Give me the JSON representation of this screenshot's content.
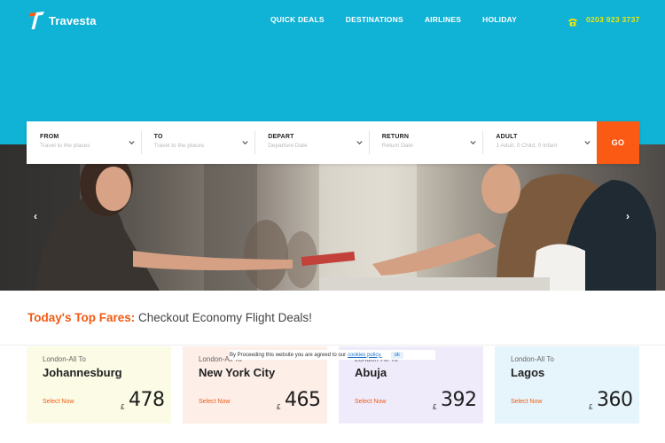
{
  "header": {
    "logo_text": "Travesta",
    "nav": [
      "QUICK DEALS",
      "DESTINATIONS",
      "AIRLINES",
      "HOLIDAY"
    ],
    "phone": "0203 923 3737"
  },
  "colors": {
    "brand_cyan": "#10b2d6",
    "accent_orange": "#fa5a14",
    "phone_yellow": "#f2e600"
  },
  "hero": {
    "prev_arrow": "‹",
    "next_arrow": "›"
  },
  "search": {
    "fields": [
      {
        "label": "FROM",
        "placeholder": "Travel to the places"
      },
      {
        "label": "TO",
        "placeholder": "Travel to the places"
      },
      {
        "label": "DEPART",
        "placeholder": "Departure Date"
      },
      {
        "label": "RETURN",
        "placeholder": "Return Date"
      },
      {
        "label": "ADULT",
        "placeholder": "1 Adult, 0 Child, 0 Infant"
      }
    ],
    "go_label": "GO"
  },
  "fares": {
    "title_highlight": "Today's Top Fares:",
    "title_rest": "Checkout Economy Flight Deals!",
    "cards": [
      {
        "route": "London-All To",
        "city": "Johannesburg",
        "select": "Select Now",
        "currency": "£",
        "price": "478",
        "bg": "#fbfbe6"
      },
      {
        "route": "London-All To",
        "city": "New York City",
        "select": "Select Now",
        "currency": "£",
        "price": "465",
        "bg": "#fdeee8"
      },
      {
        "route": "London-All To",
        "city": "Abuja",
        "select": "Select Now",
        "currency": "£",
        "price": "392",
        "bg": "#efebfb"
      },
      {
        "route": "London-All To",
        "city": "Lagos",
        "select": "Select Now",
        "currency": "£",
        "price": "360",
        "bg": "#e6f5fb"
      }
    ]
  },
  "cookie": {
    "text": "By Proceeding this website you are agreed to our",
    "link": "cookies policy.",
    "ok": "ok"
  }
}
